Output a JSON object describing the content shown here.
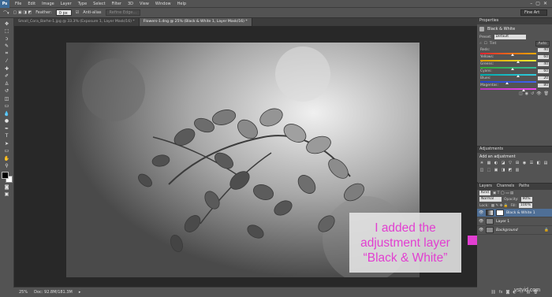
{
  "app": {
    "logo": "Ps"
  },
  "menubar": {
    "items": [
      "File",
      "Edit",
      "Image",
      "Layer",
      "Type",
      "Select",
      "Filter",
      "3D",
      "View",
      "Window",
      "Help"
    ],
    "window_controls": [
      "–",
      "▢",
      "✕"
    ]
  },
  "options_bar": {
    "feather_label": "Feather:",
    "feather_value": "0 px",
    "anti_alias_label": "Anti-alias",
    "refine_edge_label": "Refine Edge...",
    "workspace": "Fine Art"
  },
  "tabs": [
    {
      "label": "Small_Cora_Barhe-1.jpg @ 33.3% (Exposure 1, Layer Mask/16) *"
    },
    {
      "label": "Flowers-1.dng @ 25% (Black & White 1, Layer Mask/16) *"
    }
  ],
  "annotation": {
    "line1": "I added the",
    "line2": "adjustment layer",
    "line3": "“Black & White”",
    "color": "#e23fd1"
  },
  "status": {
    "zoom": "25%",
    "doc": "Doc: 92.8M/181.3M"
  },
  "properties": {
    "tab": "Properties",
    "title": "Black & White",
    "preset_label": "Preset:",
    "preset_value": "Default",
    "tint_label": "Tint",
    "auto_label": "Auto",
    "sliders": [
      {
        "label": "Reds:",
        "value": "40",
        "level": 0.55,
        "gradient": "#d23, #fa0"
      },
      {
        "label": "Yellows:",
        "value": "60",
        "level": 0.65,
        "gradient": "#d90, #ee3"
      },
      {
        "label": "Greens:",
        "value": "40",
        "level": 0.55,
        "gradient": "#3a3, #3b9"
      },
      {
        "label": "Cyans:",
        "value": "60",
        "level": 0.65,
        "gradient": "#0aa, #3cd"
      },
      {
        "label": "Blues:",
        "value": "20",
        "level": 0.45,
        "gradient": "#24c, #46e"
      },
      {
        "label": "Magentas:",
        "value": "80",
        "level": 0.75,
        "gradient": "#b3b, #e4e"
      }
    ]
  },
  "adjustments": {
    "tab": "Adjustments",
    "label": "Add an adjustment",
    "icons": [
      "☀",
      "▦",
      "◐",
      "◪",
      "▽",
      "⊞",
      "◉",
      "☰",
      "◧",
      "▤",
      "◫",
      "⬚",
      "▣",
      "◨",
      "◩",
      "▥"
    ]
  },
  "layers": {
    "tabs": [
      "Layers",
      "Channels",
      "Paths"
    ],
    "kind": "Kind",
    "blend": "Normal",
    "opacity_label": "Opacity:",
    "opacity_value": "90%",
    "lock_label": "Lock:",
    "fill_label": "Fill:",
    "fill_value": "100%",
    "items": [
      {
        "name": "Black & White 1",
        "active": true,
        "mask": true
      },
      {
        "name": "Layer 1",
        "active": false,
        "mask": false
      },
      {
        "name": "Background",
        "active": false,
        "mask": false
      }
    ]
  },
  "watermark": "vstvid.com"
}
